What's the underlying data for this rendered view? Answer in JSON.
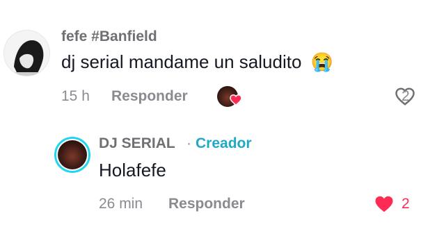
{
  "comment": {
    "username": "fefe #Banfield",
    "text": "dj serial mandame un saludito",
    "emoji": "😭",
    "time": "15 h",
    "reply_label": "Responder",
    "likes": "2"
  },
  "reply": {
    "username": "DJ SERIAL",
    "separator": "·",
    "creator_badge": "Creador",
    "text": "Holafefe",
    "time": "26 min",
    "reply_label": "Responder",
    "likes": "2"
  },
  "icons": {
    "like_outline": "heart-outline-icon",
    "like_filled": "heart-filled-icon",
    "creator_liked": "creator-liked-avatar"
  },
  "colors": {
    "text": "#161823",
    "muted": "#8a8b91",
    "creator": "#20a8c7",
    "like_red": "#fe2c55",
    "ring": "#20d5ec"
  }
}
